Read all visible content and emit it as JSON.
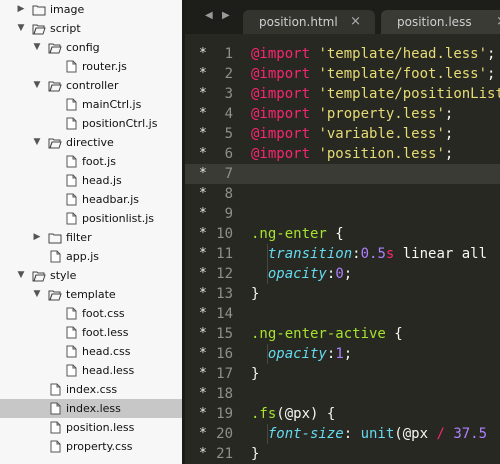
{
  "sidebar": {
    "items": [
      {
        "label": "image",
        "type": "folder",
        "expanded": false,
        "depth": 0
      },
      {
        "label": "script",
        "type": "folder",
        "expanded": true,
        "depth": 0
      },
      {
        "label": "config",
        "type": "folder",
        "expanded": true,
        "depth": 1
      },
      {
        "label": "router.js",
        "type": "file",
        "depth": 2
      },
      {
        "label": "controller",
        "type": "folder",
        "expanded": true,
        "depth": 1
      },
      {
        "label": "mainCtrl.js",
        "type": "file",
        "depth": 2
      },
      {
        "label": "positionCtrl.js",
        "type": "file",
        "depth": 2
      },
      {
        "label": "directive",
        "type": "folder",
        "expanded": true,
        "depth": 1
      },
      {
        "label": "foot.js",
        "type": "file",
        "depth": 2
      },
      {
        "label": "head.js",
        "type": "file",
        "depth": 2
      },
      {
        "label": "headbar.js",
        "type": "file",
        "depth": 2
      },
      {
        "label": "positionlist.js",
        "type": "file",
        "depth": 2
      },
      {
        "label": "filter",
        "type": "folder",
        "expanded": false,
        "depth": 1
      },
      {
        "label": "app.js",
        "type": "file",
        "depth": 1
      },
      {
        "label": "style",
        "type": "folder",
        "expanded": true,
        "depth": 0
      },
      {
        "label": "template",
        "type": "folder",
        "expanded": true,
        "depth": 1
      },
      {
        "label": "foot.css",
        "type": "file",
        "depth": 2
      },
      {
        "label": "foot.less",
        "type": "file",
        "depth": 2
      },
      {
        "label": "head.css",
        "type": "file",
        "depth": 2
      },
      {
        "label": "head.less",
        "type": "file",
        "depth": 2
      },
      {
        "label": "index.css",
        "type": "file",
        "depth": 1
      },
      {
        "label": "index.less",
        "type": "file",
        "depth": 1,
        "selected": true
      },
      {
        "label": "position.less",
        "type": "file",
        "depth": 1
      },
      {
        "label": "property.css",
        "type": "file",
        "depth": 1
      }
    ]
  },
  "tabs": [
    {
      "label": "position.html",
      "close": "×",
      "active": true
    },
    {
      "label": "position.less",
      "close": "×",
      "active": false
    }
  ],
  "editor": {
    "nav_left": "◀",
    "nav_right": "▶",
    "current_line": 7,
    "lines": [
      {
        "n": "1",
        "mark": "*",
        "tokens": [
          {
            "t": "@import",
            "c": "kw"
          },
          {
            "t": " ",
            "c": "plain"
          },
          {
            "t": "'template/head.less'",
            "c": "str"
          },
          {
            "t": ";",
            "c": "plain"
          }
        ]
      },
      {
        "n": "2",
        "mark": "*",
        "tokens": [
          {
            "t": "@import",
            "c": "kw"
          },
          {
            "t": " ",
            "c": "plain"
          },
          {
            "t": "'template/foot.less'",
            "c": "str"
          },
          {
            "t": ";",
            "c": "plain"
          }
        ]
      },
      {
        "n": "3",
        "mark": "*",
        "tokens": [
          {
            "t": "@import",
            "c": "kw"
          },
          {
            "t": " ",
            "c": "plain"
          },
          {
            "t": "'template/positionList",
            "c": "str"
          }
        ]
      },
      {
        "n": "4",
        "mark": "*",
        "tokens": [
          {
            "t": "@import",
            "c": "kw"
          },
          {
            "t": " ",
            "c": "plain"
          },
          {
            "t": "'property.less'",
            "c": "str"
          },
          {
            "t": ";",
            "c": "plain"
          }
        ]
      },
      {
        "n": "5",
        "mark": "*",
        "tokens": [
          {
            "t": "@import",
            "c": "kw"
          },
          {
            "t": " ",
            "c": "plain"
          },
          {
            "t": "'variable.less'",
            "c": "str"
          },
          {
            "t": ";",
            "c": "plain"
          }
        ]
      },
      {
        "n": "6",
        "mark": "*",
        "tokens": [
          {
            "t": "@import",
            "c": "kw"
          },
          {
            "t": " ",
            "c": "plain"
          },
          {
            "t": "'position.less'",
            "c": "str"
          },
          {
            "t": ";",
            "c": "plain"
          }
        ]
      },
      {
        "n": "7",
        "mark": "*",
        "tokens": []
      },
      {
        "n": "8",
        "mark": "*",
        "tokens": []
      },
      {
        "n": "9",
        "mark": "*",
        "tokens": []
      },
      {
        "n": "10",
        "mark": "*",
        "tokens": [
          {
            "t": ".ng-enter",
            "c": "sel"
          },
          {
            "t": " {",
            "c": "plain"
          }
        ]
      },
      {
        "n": "11",
        "mark": "*",
        "guide": true,
        "tokens": [
          {
            "t": "  ",
            "c": "plain"
          },
          {
            "t": "transition",
            "c": "prop"
          },
          {
            "t": ":",
            "c": "plain"
          },
          {
            "t": "0.5",
            "c": "num-v"
          },
          {
            "t": "s",
            "c": "unit"
          },
          {
            "t": " linear all",
            "c": "plain"
          }
        ]
      },
      {
        "n": "12",
        "mark": "*",
        "guide": true,
        "tokens": [
          {
            "t": "  ",
            "c": "plain"
          },
          {
            "t": "opacity",
            "c": "prop"
          },
          {
            "t": ":",
            "c": "plain"
          },
          {
            "t": "0",
            "c": "num-v"
          },
          {
            "t": ";",
            "c": "plain"
          }
        ]
      },
      {
        "n": "13",
        "mark": "*",
        "tokens": [
          {
            "t": "}",
            "c": "plain"
          }
        ]
      },
      {
        "n": "14",
        "mark": "*",
        "tokens": []
      },
      {
        "n": "15",
        "mark": "*",
        "tokens": [
          {
            "t": ".ng-enter-active",
            "c": "sel"
          },
          {
            "t": " {",
            "c": "plain"
          }
        ]
      },
      {
        "n": "16",
        "mark": "*",
        "guide": true,
        "tokens": [
          {
            "t": "  ",
            "c": "plain"
          },
          {
            "t": "opacity",
            "c": "prop"
          },
          {
            "t": ":",
            "c": "plain"
          },
          {
            "t": "1",
            "c": "num-v"
          },
          {
            "t": ";",
            "c": "plain"
          }
        ]
      },
      {
        "n": "17",
        "mark": "*",
        "tokens": [
          {
            "t": "}",
            "c": "plain"
          }
        ]
      },
      {
        "n": "18",
        "mark": "*",
        "tokens": []
      },
      {
        "n": "19",
        "mark": "*",
        "tokens": [
          {
            "t": ".fs",
            "c": "sel"
          },
          {
            "t": "(@px) {",
            "c": "plain"
          }
        ]
      },
      {
        "n": "20",
        "mark": "*",
        "guide": true,
        "tokens": [
          {
            "t": "  ",
            "c": "plain"
          },
          {
            "t": "font-size",
            "c": "prop"
          },
          {
            "t": ": ",
            "c": "plain"
          },
          {
            "t": "unit",
            "c": "fn"
          },
          {
            "t": "(@px ",
            "c": "plain"
          },
          {
            "t": "/",
            "c": "kw"
          },
          {
            "t": " ",
            "c": "plain"
          },
          {
            "t": "37.5",
            "c": "num-v"
          }
        ]
      },
      {
        "n": "21",
        "mark": "*",
        "tokens": [
          {
            "t": "}",
            "c": "plain"
          }
        ]
      }
    ]
  },
  "colors": {
    "sidebar_bg": "#f7f7f7",
    "selected_row": "#c7c7c7",
    "editor_bg": "#272822",
    "keyword": "#f92672",
    "string": "#e6db74",
    "selector": "#a6e22e",
    "property": "#66d9ef",
    "number": "#ae81ff"
  }
}
